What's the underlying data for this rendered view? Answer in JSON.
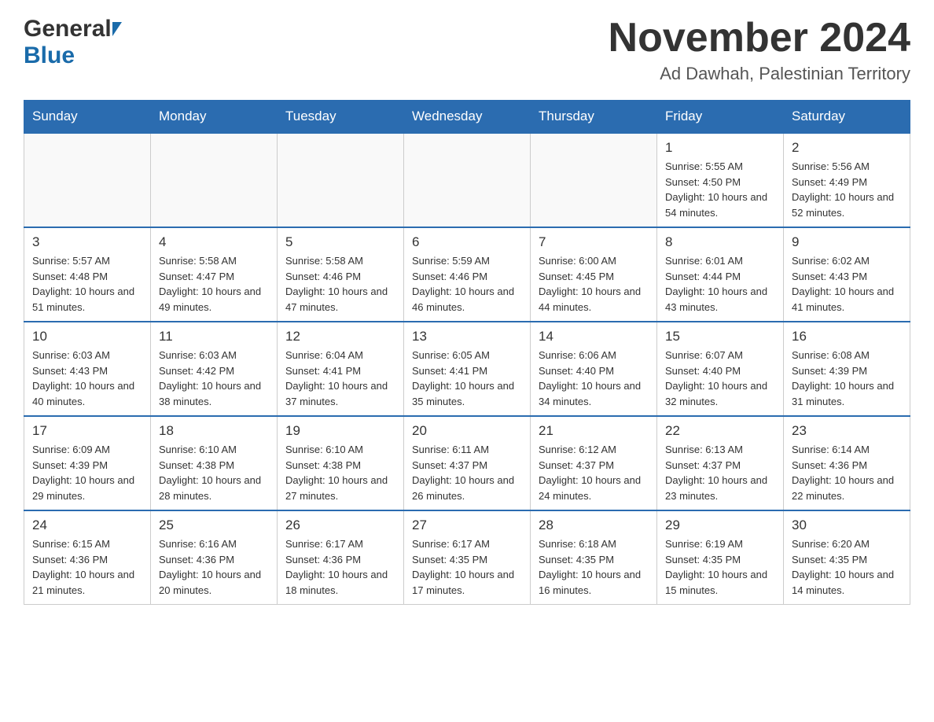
{
  "header": {
    "logo_general": "General",
    "logo_blue": "Blue",
    "month_title": "November 2024",
    "subtitle": "Ad Dawhah, Palestinian Territory"
  },
  "weekdays": [
    "Sunday",
    "Monday",
    "Tuesday",
    "Wednesday",
    "Thursday",
    "Friday",
    "Saturday"
  ],
  "weeks": [
    [
      {
        "day": "",
        "info": ""
      },
      {
        "day": "",
        "info": ""
      },
      {
        "day": "",
        "info": ""
      },
      {
        "day": "",
        "info": ""
      },
      {
        "day": "",
        "info": ""
      },
      {
        "day": "1",
        "info": "Sunrise: 5:55 AM\nSunset: 4:50 PM\nDaylight: 10 hours and 54 minutes."
      },
      {
        "day": "2",
        "info": "Sunrise: 5:56 AM\nSunset: 4:49 PM\nDaylight: 10 hours and 52 minutes."
      }
    ],
    [
      {
        "day": "3",
        "info": "Sunrise: 5:57 AM\nSunset: 4:48 PM\nDaylight: 10 hours and 51 minutes."
      },
      {
        "day": "4",
        "info": "Sunrise: 5:58 AM\nSunset: 4:47 PM\nDaylight: 10 hours and 49 minutes."
      },
      {
        "day": "5",
        "info": "Sunrise: 5:58 AM\nSunset: 4:46 PM\nDaylight: 10 hours and 47 minutes."
      },
      {
        "day": "6",
        "info": "Sunrise: 5:59 AM\nSunset: 4:46 PM\nDaylight: 10 hours and 46 minutes."
      },
      {
        "day": "7",
        "info": "Sunrise: 6:00 AM\nSunset: 4:45 PM\nDaylight: 10 hours and 44 minutes."
      },
      {
        "day": "8",
        "info": "Sunrise: 6:01 AM\nSunset: 4:44 PM\nDaylight: 10 hours and 43 minutes."
      },
      {
        "day": "9",
        "info": "Sunrise: 6:02 AM\nSunset: 4:43 PM\nDaylight: 10 hours and 41 minutes."
      }
    ],
    [
      {
        "day": "10",
        "info": "Sunrise: 6:03 AM\nSunset: 4:43 PM\nDaylight: 10 hours and 40 minutes."
      },
      {
        "day": "11",
        "info": "Sunrise: 6:03 AM\nSunset: 4:42 PM\nDaylight: 10 hours and 38 minutes."
      },
      {
        "day": "12",
        "info": "Sunrise: 6:04 AM\nSunset: 4:41 PM\nDaylight: 10 hours and 37 minutes."
      },
      {
        "day": "13",
        "info": "Sunrise: 6:05 AM\nSunset: 4:41 PM\nDaylight: 10 hours and 35 minutes."
      },
      {
        "day": "14",
        "info": "Sunrise: 6:06 AM\nSunset: 4:40 PM\nDaylight: 10 hours and 34 minutes."
      },
      {
        "day": "15",
        "info": "Sunrise: 6:07 AM\nSunset: 4:40 PM\nDaylight: 10 hours and 32 minutes."
      },
      {
        "day": "16",
        "info": "Sunrise: 6:08 AM\nSunset: 4:39 PM\nDaylight: 10 hours and 31 minutes."
      }
    ],
    [
      {
        "day": "17",
        "info": "Sunrise: 6:09 AM\nSunset: 4:39 PM\nDaylight: 10 hours and 29 minutes."
      },
      {
        "day": "18",
        "info": "Sunrise: 6:10 AM\nSunset: 4:38 PM\nDaylight: 10 hours and 28 minutes."
      },
      {
        "day": "19",
        "info": "Sunrise: 6:10 AM\nSunset: 4:38 PM\nDaylight: 10 hours and 27 minutes."
      },
      {
        "day": "20",
        "info": "Sunrise: 6:11 AM\nSunset: 4:37 PM\nDaylight: 10 hours and 26 minutes."
      },
      {
        "day": "21",
        "info": "Sunrise: 6:12 AM\nSunset: 4:37 PM\nDaylight: 10 hours and 24 minutes."
      },
      {
        "day": "22",
        "info": "Sunrise: 6:13 AM\nSunset: 4:37 PM\nDaylight: 10 hours and 23 minutes."
      },
      {
        "day": "23",
        "info": "Sunrise: 6:14 AM\nSunset: 4:36 PM\nDaylight: 10 hours and 22 minutes."
      }
    ],
    [
      {
        "day": "24",
        "info": "Sunrise: 6:15 AM\nSunset: 4:36 PM\nDaylight: 10 hours and 21 minutes."
      },
      {
        "day": "25",
        "info": "Sunrise: 6:16 AM\nSunset: 4:36 PM\nDaylight: 10 hours and 20 minutes."
      },
      {
        "day": "26",
        "info": "Sunrise: 6:17 AM\nSunset: 4:36 PM\nDaylight: 10 hours and 18 minutes."
      },
      {
        "day": "27",
        "info": "Sunrise: 6:17 AM\nSunset: 4:35 PM\nDaylight: 10 hours and 17 minutes."
      },
      {
        "day": "28",
        "info": "Sunrise: 6:18 AM\nSunset: 4:35 PM\nDaylight: 10 hours and 16 minutes."
      },
      {
        "day": "29",
        "info": "Sunrise: 6:19 AM\nSunset: 4:35 PM\nDaylight: 10 hours and 15 minutes."
      },
      {
        "day": "30",
        "info": "Sunrise: 6:20 AM\nSunset: 4:35 PM\nDaylight: 10 hours and 14 minutes."
      }
    ]
  ]
}
